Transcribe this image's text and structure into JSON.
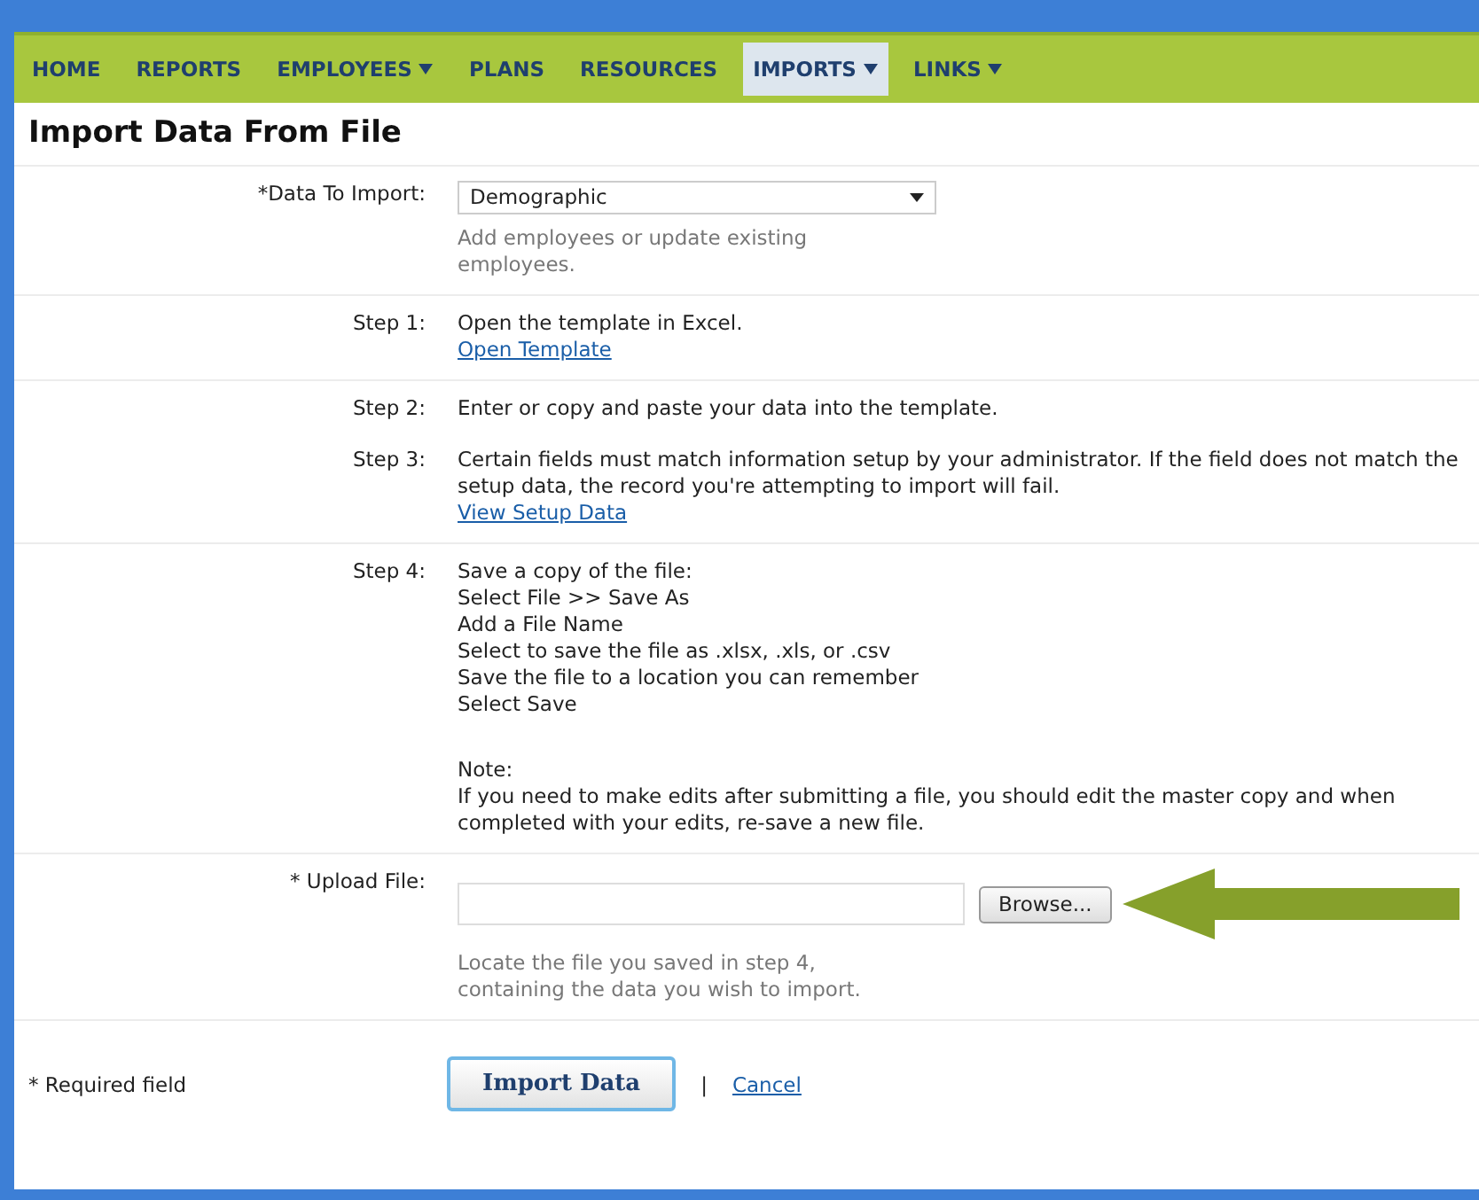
{
  "nav": [
    {
      "label": "HOME",
      "dropdown": false,
      "selected": false
    },
    {
      "label": "REPORTS",
      "dropdown": false,
      "selected": false
    },
    {
      "label": "EMPLOYEES",
      "dropdown": true,
      "selected": false
    },
    {
      "label": "PLANS",
      "dropdown": false,
      "selected": false
    },
    {
      "label": "RESOURCES",
      "dropdown": false,
      "selected": false
    },
    {
      "label": "IMPORTS",
      "dropdown": true,
      "selected": true
    },
    {
      "label": "LINKS",
      "dropdown": true,
      "selected": false
    }
  ],
  "title": "Import Data From File",
  "sections": [
    {
      "rows": [
        {
          "kind": "select",
          "label": "*Data To Import:",
          "value": "Demographic",
          "hint": "Add employees or update existing employees."
        }
      ]
    },
    {
      "rows": [
        {
          "kind": "text",
          "label": "Step 1:",
          "paragraphs": [
            [
              "Open the template in Excel."
            ]
          ],
          "link": "Open Template"
        }
      ]
    },
    {
      "rows": [
        {
          "kind": "text",
          "label": "Step 2:",
          "paragraphs": [
            [
              "Enter or copy and paste your data into the template."
            ]
          ]
        },
        {
          "kind": "text",
          "label": "Step 3:",
          "paragraphs": [
            [
              "Certain fields must match information setup by your administrator. If the field does not match the setup data, the record you're attempting to import will fail."
            ]
          ],
          "link": "View Setup Data"
        }
      ]
    },
    {
      "rows": [
        {
          "kind": "text",
          "label": "Step 4:",
          "paragraphs": [
            [
              "Save a copy of the file:",
              "Select File >> Save As",
              "Add a File Name",
              "Select to save the file as .xlsx, .xls, or .csv",
              "Save the file to a location you can remember",
              "Select Save"
            ],
            [
              "Note:",
              "If you need to make edits after submitting a file, you should edit the master copy and when completed with your edits, re-save a new file."
            ]
          ]
        }
      ]
    },
    {
      "rows": [
        {
          "kind": "upload",
          "label": "* Upload File:",
          "button": "Browse...",
          "hint": "Locate the file you saved in step 4, containing the data you wish to import."
        }
      ]
    }
  ],
  "footer": {
    "required_note": "* Required field",
    "submit": "Import Data",
    "separator": "|",
    "cancel": "Cancel"
  }
}
